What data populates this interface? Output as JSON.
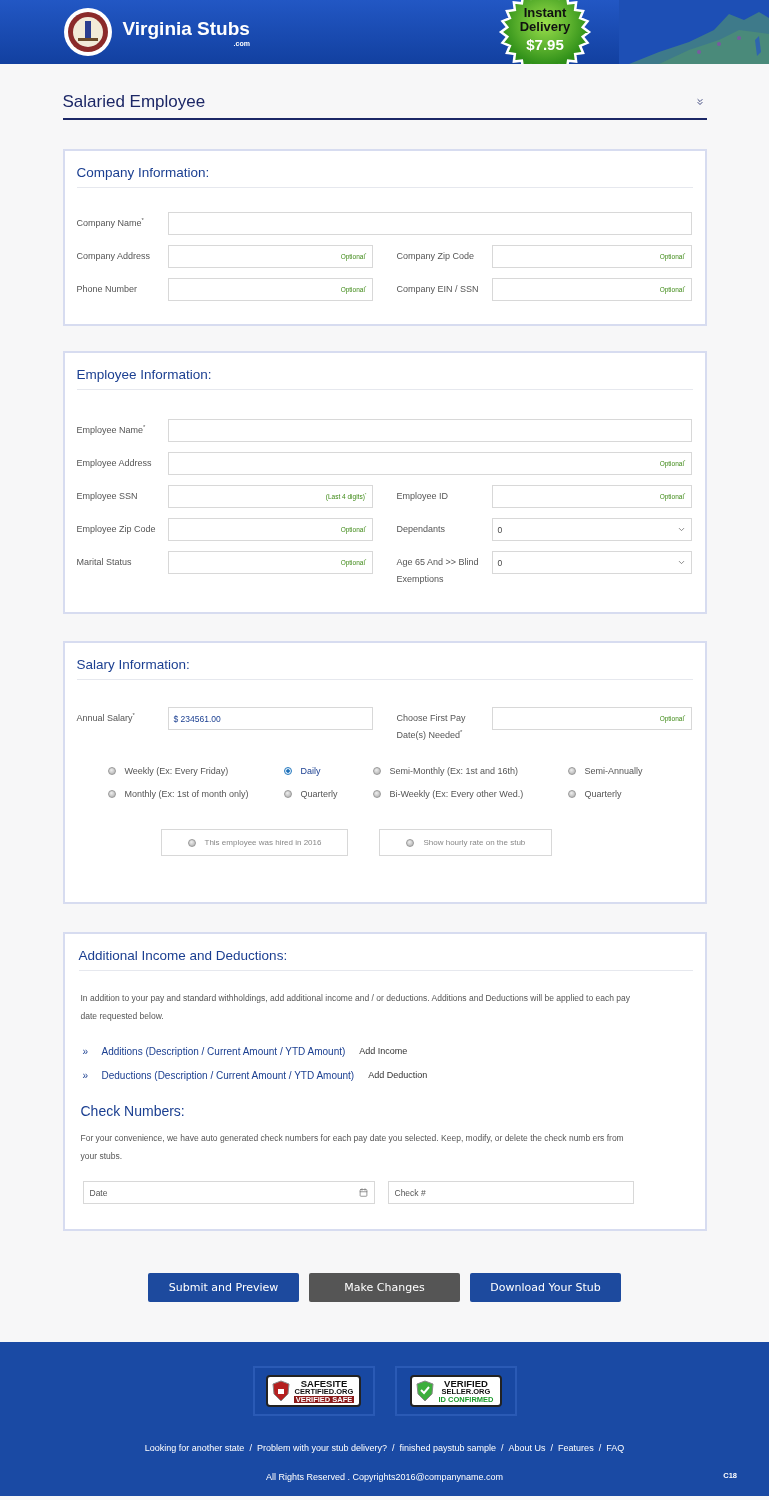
{
  "header": {
    "brand": "Virginia Stubs",
    "domain": ".com",
    "promo": {
      "line1": "Instant",
      "line2": "Delivery",
      "price": "$7.95"
    }
  },
  "page_title": "Salaried Employee",
  "company": {
    "title": "Company Information:",
    "rows": [
      [
        {
          "label": "Company Name$^{*}$",
          "kind": "text"
        }
      ],
      [
        {
          "label": "Company Address",
          "kind": "text",
          "hint": "Optional$^{*}$"
        },
        {
          "label": "Company Zip Code",
          "kind": "text",
          "hint": "Optional$^{*}$"
        }
      ],
      [
        {
          "label": "Phone Number",
          "kind": "text",
          "hint": "Optional$^{*}$"
        },
        {
          "label": "Company EIN / SSN",
          "kind": "text",
          "hint": "Optional$^{*}$"
        }
      ]
    ]
  },
  "employee": {
    "title": "Employee Information:",
    "rows": [
      [
        {
          "label": "Employee Name$^{*}$",
          "kind": "text"
        }
      ],
      [
        {
          "label": "Employee Address",
          "kind": "text",
          "hint": "Optional$^{*}$"
        }
      ],
      [
        {
          "label": "Employee SSN",
          "kind": "text",
          "hint": "(Last 4 digits)$^{*}$"
        },
        {
          "label": "Employee ID",
          "kind": "text",
          "hint": "Optional$^{*}$"
        }
      ],
      [
        {
          "label": "Employee Zip Code",
          "kind": "text",
          "hint": "Optional$^{*}$"
        },
        {
          "label": "Dependants",
          "kind": "select",
          "value": "0"
        }
      ],
      [
        {
          "label": "Marital Status",
          "kind": "text",
          "hint": "Optional$^{*}$"
        },
        {
          "label": "Age 65 And >> Blind Exemptions",
          "kind": "select",
          "value": "0"
        }
      ]
    ]
  },
  "salary": {
    "title": "Salary Information:",
    "rows": [
      [
        {
          "label": "Annual Salary$^{*}$",
          "kind": "text",
          "value": "$ 234561.00"
        },
        {
          "label": "Choose First Pay Date(s) Needed$^{*}$",
          "kind": "text",
          "hint": "Optional$^{*}$"
        }
      ]
    ],
    "frequencies": [
      {
        "label": "Weekly (Ex: Every Friday)",
        "selected": false
      },
      {
        "label": "Daily",
        "selected": true
      },
      {
        "label": "Semi-Monthly (Ex: 1st and 16th)",
        "selected": false
      },
      {
        "label": "Semi-Annually",
        "selected": false
      },
      {
        "label": "Monthly (Ex: 1st of month only)",
        "selected": false
      },
      {
        "label": "Quarterly",
        "selected": false
      },
      {
        "label": "Bi-Weekly (Ex: Every other Wed.)",
        "selected": false
      },
      {
        "label": "Quarterly",
        "selected": false
      }
    ],
    "toggles": [
      {
        "label": "This employee was hired in 2016",
        "checked": false
      },
      {
        "label": "Show hourly rate on the stub",
        "checked": false
      }
    ]
  },
  "extras": {
    "title": "Additional Income and Deductions:",
    "intro": "In addition to your pay and standard withholdings, add additional income and / or deductions. Additions and Deductions will be applied to each pay date requested below.",
    "items": [
      {
        "marker": "»",
        "label": "Additions (Description / Current Amount / YTD Amount)",
        "action": "Add Income"
      },
      {
        "marker": "»",
        "label": "Deductions (Description / Current Amount / YTD Amount)",
        "action": "Add Deduction"
      }
    ],
    "check_title": "Check Numbers:",
    "check_intro": "For your convenience, we have auto generated check numbers for each pay date you selected. Keep, modify, or delete the check numb ers from your stubs.",
    "check_fields": [
      {
        "kind": "date",
        "placeholder": "Date"
      },
      {
        "kind": "text",
        "placeholder": "Check #"
      }
    ]
  },
  "buttons": [
    {
      "label": "Submit and Preview",
      "kind": "primary"
    },
    {
      "label": "Make Changes",
      "kind": "secondary"
    },
    {
      "label": "Download Your Stub",
      "kind": "primary"
    }
  ],
  "footer": {
    "badges": [
      {
        "kind": "safesite",
        "lines": [
          "SAFESITE",
          "CERTIFIED.ORG",
          "VERIFIED SAFE"
        ]
      },
      {
        "kind": "verified",
        "lines": [
          "VERIFIED",
          "SELLER.ORG",
          "ID CONFIRMED"
        ]
      }
    ],
    "separator": "/",
    "links": [
      "Looking for another state",
      "Problem with your stub delivery?",
      "finished paystub sample",
      "About Us",
      "Features",
      "FAQ"
    ],
    "copyright": "All Rights Reserved . Copyrights2016@companyname.com",
    "code": "C18"
  }
}
